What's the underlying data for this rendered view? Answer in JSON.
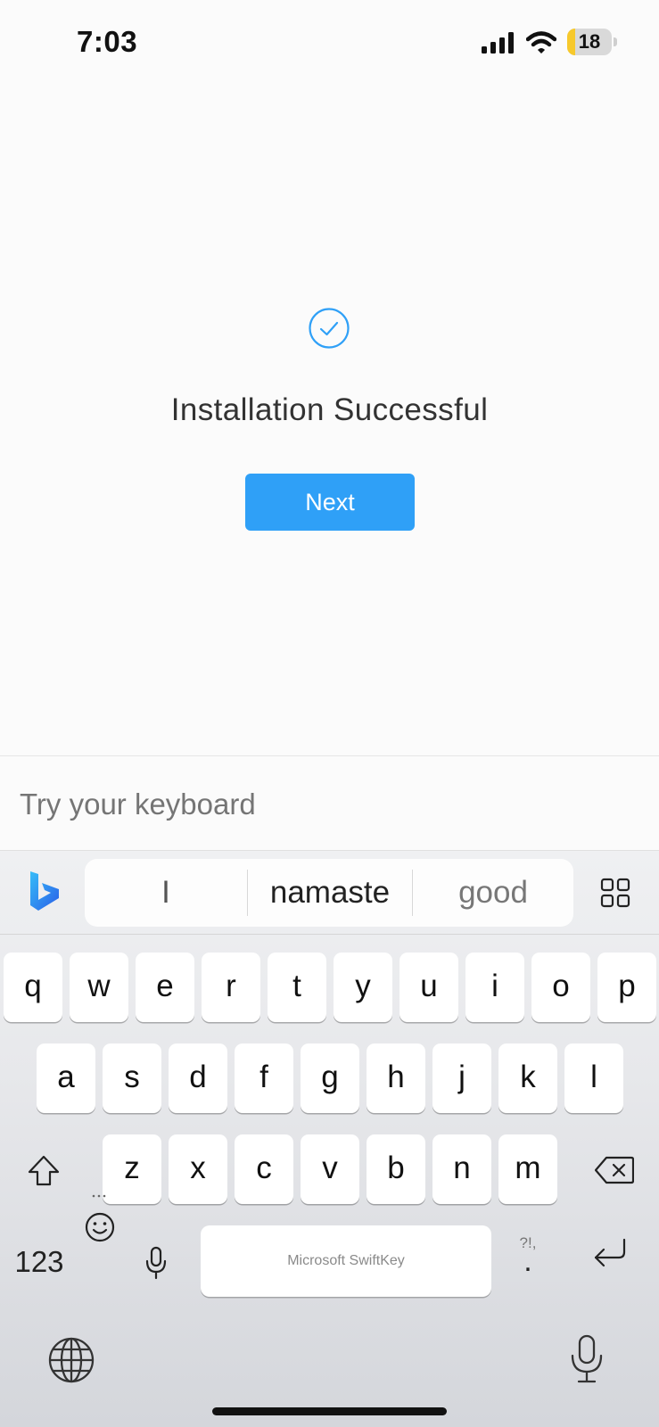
{
  "status_bar": {
    "time": "7:03",
    "battery_level": "18",
    "battery_fraction": 0.18
  },
  "main": {
    "title": "Installation Successful",
    "next_label": "Next"
  },
  "input": {
    "placeholder": "Try your keyboard"
  },
  "keyboard": {
    "suggestions": [
      "I",
      "namaste",
      "good"
    ],
    "row1": [
      "q",
      "w",
      "e",
      "r",
      "t",
      "y",
      "u",
      "i",
      "o",
      "p"
    ],
    "row2": [
      "a",
      "s",
      "d",
      "f",
      "g",
      "h",
      "j",
      "k",
      "l"
    ],
    "row3": [
      "z",
      "x",
      "c",
      "v",
      "b",
      "n",
      "m"
    ],
    "numbers_label": "123",
    "space_label": "Microsoft SwiftKey",
    "punct_hint": "?!,",
    "punct_main": "."
  },
  "colors": {
    "accent": "#2fa0f7",
    "battery_low": "#f7c92c"
  }
}
